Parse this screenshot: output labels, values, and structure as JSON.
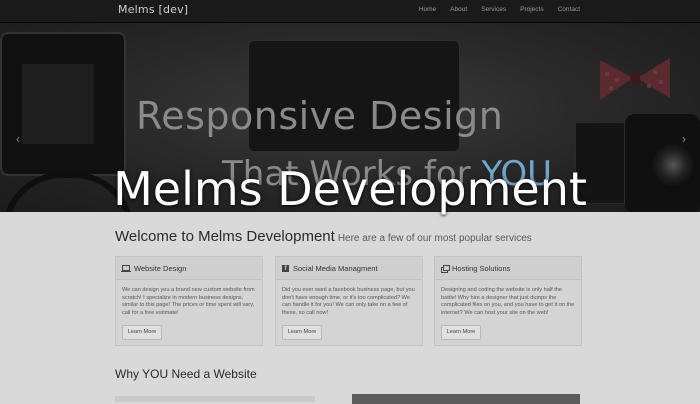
{
  "brand": "Melms [dev]",
  "nav": {
    "items": [
      "Home",
      "About",
      "Services",
      "Projects",
      "Contact"
    ]
  },
  "hero": {
    "line1": "Responsive Design",
    "line2_prefix": "That Works for ",
    "line2_highlight": "YOU",
    "prev_arrow": "‹",
    "next_arrow": "›"
  },
  "overlay_title": "Melms Development",
  "welcome": {
    "title": "Welcome to Melms Development",
    "subtitle": "Here are a few of our most popular services"
  },
  "cards": [
    {
      "icon": "laptop-icon",
      "title": "Website Design",
      "body": "We can design you a brand new custom website from scratch! I specialize in modern business designs, similar to this page! The prices or time spent will vary, call for a free estimate!",
      "button": "Learn More"
    },
    {
      "icon": "facebook-icon",
      "title": "Social Media Managment",
      "body": "Did you ever want a facebook business page, but you don't have enough time, or it's too complicated? We can handle it for you! We can only take on a few of these, so call now!",
      "button": "Learn More"
    },
    {
      "icon": "windows-icon",
      "title": "Hosting Solutions",
      "body": "Designing and coding the website is only half the battle! Why hire a designer that just dumps the complicated files on you, and you have to get it on the internet? We can host your site on the web!",
      "button": "Learn More"
    }
  ],
  "why": {
    "title": "Why YOU Need a Website"
  },
  "colors": {
    "navbar": "#1a1a1a",
    "hero_text": "#8a8a8a",
    "accent_blue": "#6fa6c9",
    "page_bg": "#d9d9d9"
  }
}
